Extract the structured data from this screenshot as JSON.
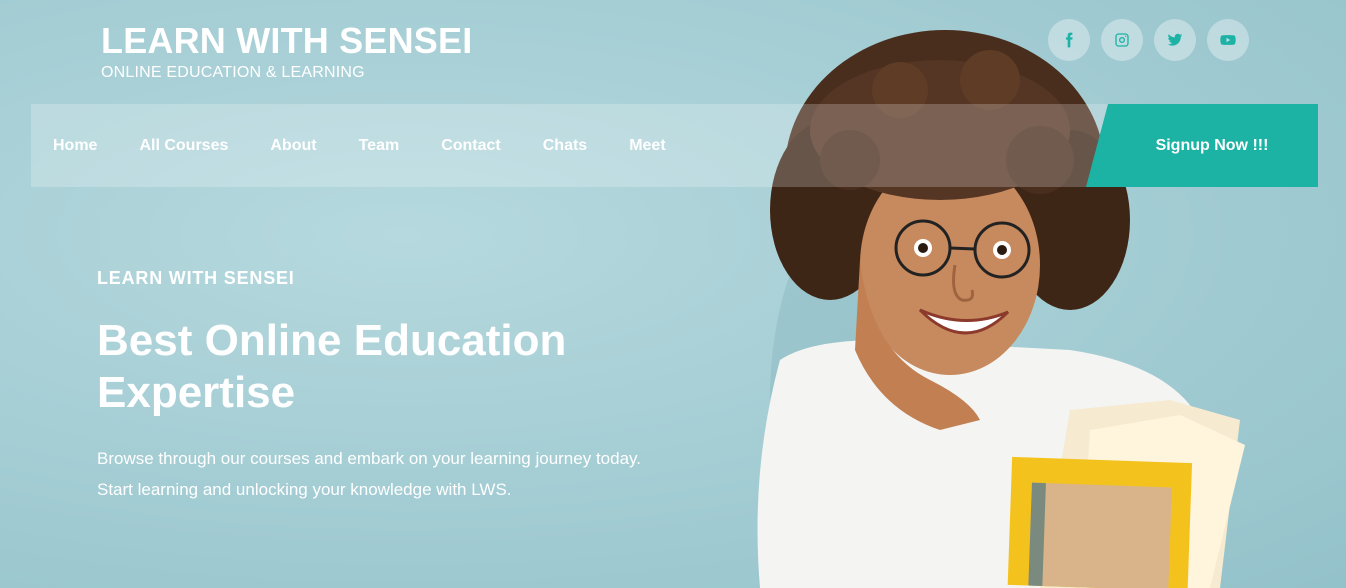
{
  "brand": {
    "title": "LEARN WITH SENSEI",
    "subtitle": "ONLINE EDUCATION & LEARNING"
  },
  "socials": [
    {
      "icon": "facebook-icon"
    },
    {
      "icon": "instagram-icon"
    },
    {
      "icon": "twitter-icon"
    },
    {
      "icon": "youtube-icon"
    }
  ],
  "nav": {
    "links": [
      "Home",
      "All Courses",
      "About",
      "Team",
      "Contact",
      "Chats",
      "Meet"
    ],
    "signup_label": "Signup Now !!!"
  },
  "hero": {
    "eyebrow": "LEARN WITH SENSEI",
    "headline": "Best Online Education Expertise",
    "description": "Browse through our courses and embark on your learning journey today. Start learning and unlocking your knowledge with LWS."
  },
  "colors": {
    "accent": "#1db3a4",
    "background": "#a7cfd6"
  }
}
